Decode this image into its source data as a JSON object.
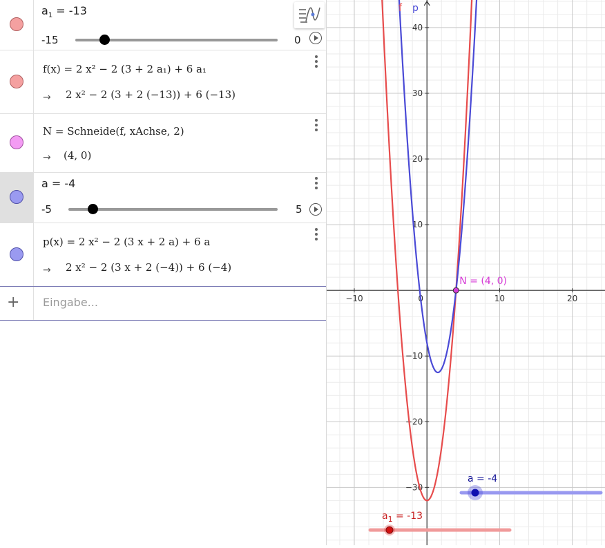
{
  "algebra": {
    "rows": [
      {
        "name": "a1-slider",
        "label_main": "a",
        "label_sub": "1",
        "label_rest": " = -13",
        "min": "-15",
        "max": "0",
        "value": -13,
        "range": [
          -15,
          0
        ],
        "color": "#f4a0a0"
      },
      {
        "name": "f-def",
        "def": "f(x) = 2 x² − 2 (3 + 2 a₁) + 6 a₁",
        "val": "2 x² − 2 (3 + 2 (−13)) + 6 (−13)",
        "color": "#f4a0a0"
      },
      {
        "name": "N-def",
        "def": "N = Schneide(f, xAchse, 2)",
        "val": "(4,  0)",
        "color": "#f39bf3"
      },
      {
        "name": "a-slider",
        "label": "a = -4",
        "min": "-5",
        "max": "5",
        "value": -4,
        "range": [
          -5,
          5
        ],
        "color": "#9a9af0"
      },
      {
        "name": "p-def",
        "def": "p(x) = 2 x² − 2 (3 x + 2 a) + 6 a",
        "val": "2 x² − 2 (3 x + 2 (−4)) + 6 (−4)",
        "color": "#9a9af0"
      }
    ],
    "arrow": "→",
    "input_placeholder": "Eingabe...",
    "plus": "+"
  },
  "graph": {
    "x_ticks": [
      "−10",
      "0",
      "10",
      "20"
    ],
    "y_ticks": [
      "40",
      "30",
      "20",
      "10",
      "−10",
      "−20",
      "−30"
    ],
    "f_label": "f",
    "p_label": "p",
    "point_label": "N = (4, 0)",
    "slider_a_label": "a = -4",
    "slider_a1_label_main": "a",
    "slider_a1_label_sub": "1",
    "slider_a1_label_rest": " = -13",
    "f_color": "#e74c4c",
    "p_color": "#4a4ad6",
    "point_color": "#d63bd6"
  },
  "chart_data": {
    "type": "line",
    "series": [
      {
        "name": "f",
        "expression": "2x² − 2(3 + 2a₁) + 6a₁",
        "parameter": {
          "a₁": -13
        },
        "color": "#e74c4c"
      },
      {
        "name": "p",
        "expression": "2x² − 2(3x + 2a) + 6a",
        "parameter": {
          "a": -4
        },
        "color": "#4a4ad6"
      }
    ],
    "points": [
      {
        "label": "N = (4, 0)",
        "x": 4,
        "y": 0
      }
    ],
    "xlim": [
      -13.8,
      24.5
    ],
    "ylim": [
      -38.8,
      44.2
    ],
    "grid": true
  }
}
